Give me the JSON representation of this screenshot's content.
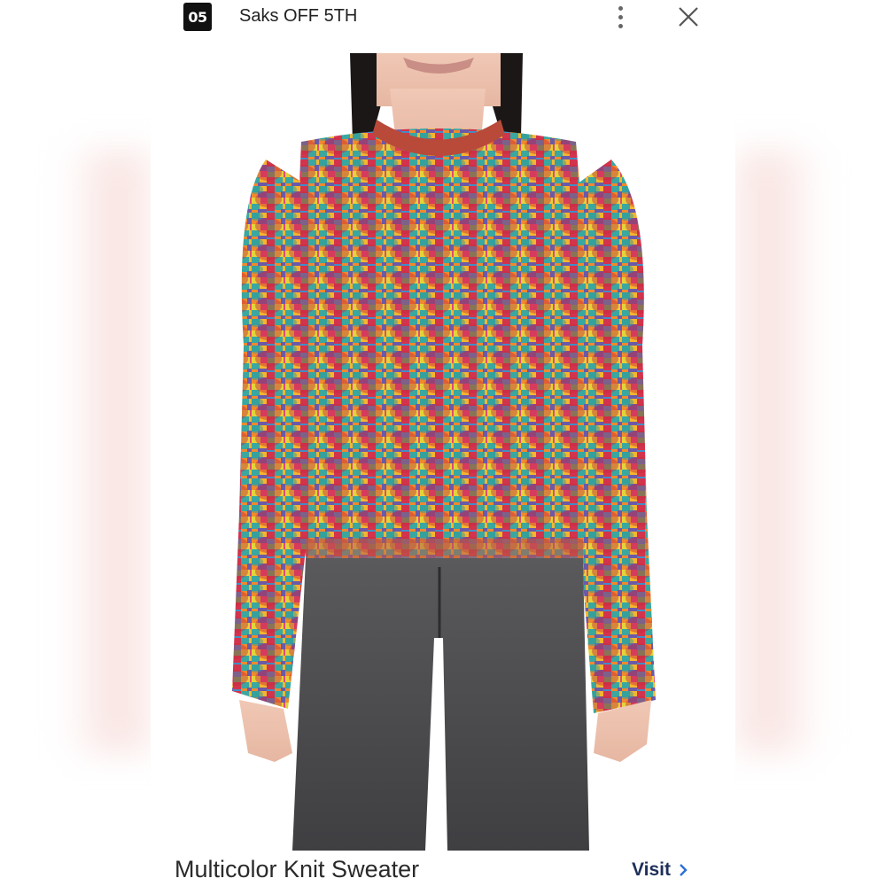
{
  "header": {
    "logo_text": "05",
    "site_name": "Saks OFF 5TH",
    "menu_icon": "more-vert-icon",
    "close_icon": "close-icon"
  },
  "product": {
    "title": "Multicolor Knit Sweater",
    "image_description": "model wearing multicolor knit sweater with puff sleeves and gray jeans"
  },
  "actions": {
    "visit_label": "Visit",
    "visit_icon": "chevron-right-icon"
  },
  "colors": {
    "link": "#1e2f5a",
    "logo_bg": "#111111"
  }
}
